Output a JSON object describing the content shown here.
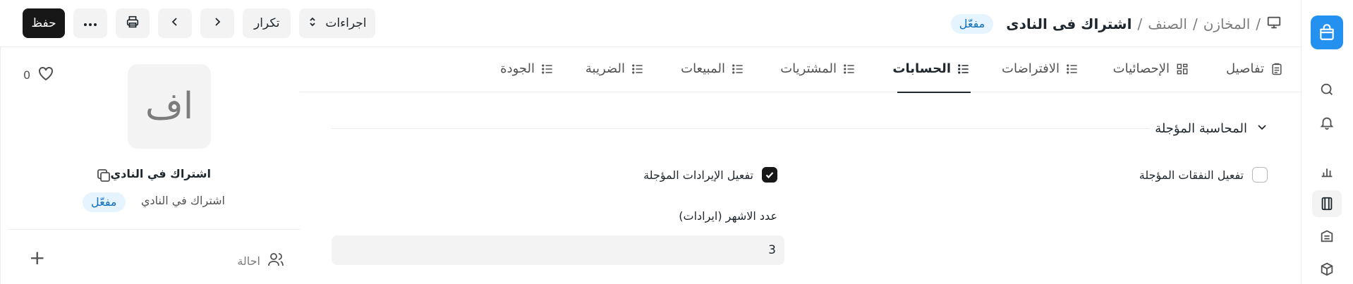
{
  "header": {
    "breadcrumb": [
      "المخازن",
      "الصنف"
    ],
    "title": "اشتراك فى النادى",
    "status": "مفعّل"
  },
  "toolbar": {
    "actions_label": "اجراءات",
    "duplicate_label": "تكرار",
    "save_label": "حفظ"
  },
  "sidebar": {
    "avatar_initials": "اف",
    "likes": "0",
    "item_name": "اشتراك في النادي",
    "item_subtitle": "اشتراك في النادي",
    "status": "مفعّل",
    "assign_label": "احالة"
  },
  "tabs": [
    {
      "label": "تفاصيل"
    },
    {
      "label": "الإحصائيات"
    },
    {
      "label": "الافتراضات"
    },
    {
      "label": "الحسابات"
    },
    {
      "label": "المشتريات"
    },
    {
      "label": "المبيعات"
    },
    {
      "label": "الضريبة"
    },
    {
      "label": "الجودة"
    }
  ],
  "active_tab": "الحسابات",
  "section": {
    "title": "المحاسبة المؤجلة",
    "deferred_expense_label": "تفعيل النفقات المؤجلة",
    "deferred_expense_checked": false,
    "deferred_revenue_label": "تفعيل الإيرادات المؤجلة",
    "deferred_revenue_checked": true,
    "months_label": "عدد الاشهر (ايرادات)",
    "months_value": "3"
  },
  "colors": {
    "accent": "#2490ef",
    "badge_bg": "#e6f4ff",
    "badge_text": "#0c6ebf",
    "primary_button": "#171717"
  }
}
